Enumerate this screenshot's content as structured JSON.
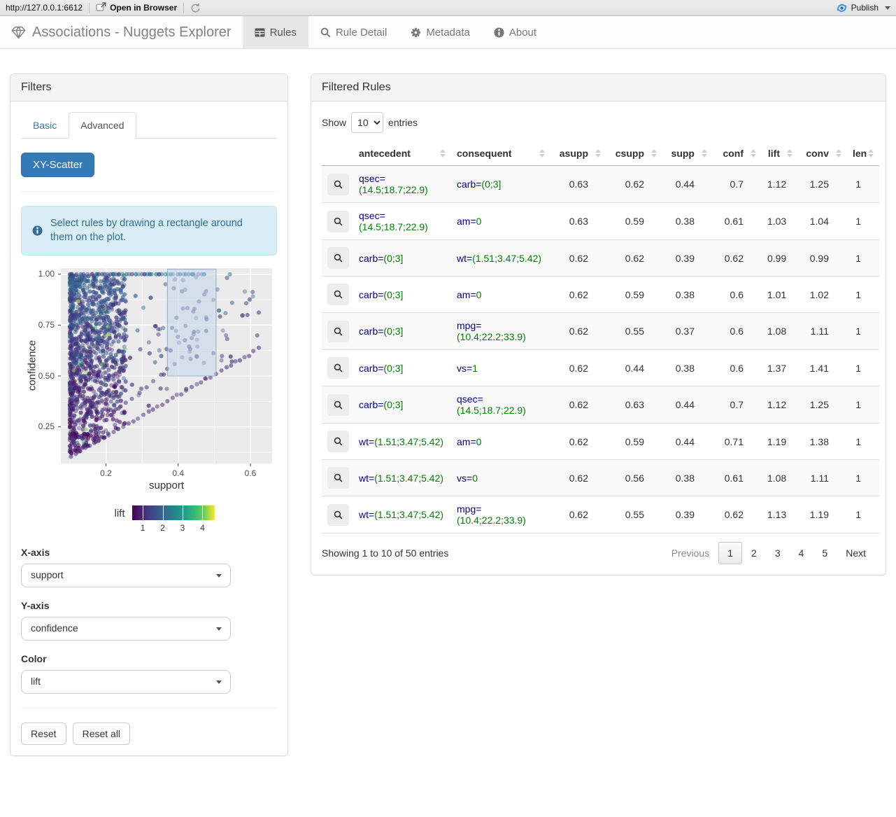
{
  "browser": {
    "url": "http://127.0.0.1:6612",
    "open_in_browser": "Open in Browser",
    "publish": "Publish"
  },
  "navbar": {
    "title": "Associations - Nuggets Explorer",
    "tabs": [
      {
        "label": "Rules",
        "icon": "table-icon",
        "active": true
      },
      {
        "label": "Rule Detail",
        "icon": "search-icon",
        "active": false
      },
      {
        "label": "Metadata",
        "icon": "gear-icon",
        "active": false
      },
      {
        "label": "About",
        "icon": "info-icon",
        "active": false
      }
    ]
  },
  "filters": {
    "title": "Filters",
    "tabs": [
      {
        "label": "Basic",
        "active": false
      },
      {
        "label": "Advanced",
        "active": true
      }
    ],
    "scatter_button": "XY-Scatter",
    "info_text": "Select rules by drawing a rectangle around them on the plot.",
    "controls": [
      {
        "label": "X-axis",
        "value": "support",
        "name": "x-axis"
      },
      {
        "label": "Y-axis",
        "value": "confidence",
        "name": "y-axis"
      },
      {
        "label": "Color",
        "value": "lift",
        "name": "color"
      }
    ],
    "reset": "Reset",
    "reset_all": "Reset all"
  },
  "chart_data": {
    "type": "scatter",
    "xlabel": "support",
    "ylabel": "confidence",
    "xlim": [
      0.075,
      0.66
    ],
    "ylim": [
      0.07,
      1.03
    ],
    "x_ticks": [
      {
        "v": 0.2,
        "label": "0.2"
      },
      {
        "v": 0.4,
        "label": "0.4"
      },
      {
        "v": 0.6,
        "label": "0.6"
      }
    ],
    "x_minor": [
      0.1,
      0.3,
      0.5
    ],
    "y_ticks": [
      {
        "v": 0.25,
        "label": "0.25"
      },
      {
        "v": 0.5,
        "label": "0.50"
      },
      {
        "v": 0.75,
        "label": "0.75"
      },
      {
        "v": 1.0,
        "label": "1.00"
      }
    ],
    "y_minor": [
      0.125,
      0.375,
      0.625,
      0.875
    ],
    "grid": true,
    "panel_bg": "#EBEBEB",
    "legend": {
      "label": "lift",
      "ticks": [
        1,
        2,
        3,
        4
      ],
      "range": [
        0.45,
        4.6
      ],
      "colormap": "viridis"
    },
    "brush": {
      "x1": 0.37,
      "x2": 0.505,
      "y1": 0.5,
      "y2": 1.025
    },
    "n_points": 1500,
    "seed": 7
  },
  "colors": {
    "accent": "#337ab7",
    "attr": "#00008B",
    "value": "#008000",
    "viridis": [
      "#440154",
      "#482878",
      "#3e4a89",
      "#31688e",
      "#26828e",
      "#1f9e89",
      "#35b779",
      "#6ece58",
      "#fde725"
    ]
  },
  "table": {
    "title": "Filtered Rules",
    "show_label": "Show",
    "page_length": "10",
    "entries_label": "entries",
    "columns": [
      "antecedent",
      "consequent",
      "asupp",
      "csupp",
      "supp",
      "conf",
      "lift",
      "conv",
      "len"
    ],
    "rows": [
      {
        "antecedent": {
          "attr": "qsec=",
          "value": "(14.5;18.7;22.9)"
        },
        "consequent": {
          "attr": "carb=",
          "value": "(0;3]"
        },
        "values": [
          "0.63",
          "0.62",
          "0.44",
          "0.7",
          "1.12",
          "1.25",
          "1"
        ]
      },
      {
        "antecedent": {
          "attr": "qsec=",
          "value": "(14.5;18.7;22.9)"
        },
        "consequent": {
          "attr": "am=",
          "value": "0"
        },
        "values": [
          "0.63",
          "0.59",
          "0.38",
          "0.61",
          "1.03",
          "1.04",
          "1"
        ]
      },
      {
        "antecedent": {
          "attr": "carb=",
          "value": "(0;3]"
        },
        "consequent": {
          "attr": "wt=",
          "value": "(1.51;3.47;5.42)"
        },
        "values": [
          "0.62",
          "0.62",
          "0.39",
          "0.62",
          "0.99",
          "0.99",
          "1"
        ]
      },
      {
        "antecedent": {
          "attr": "carb=",
          "value": "(0;3]"
        },
        "consequent": {
          "attr": "am=",
          "value": "0"
        },
        "values": [
          "0.62",
          "0.59",
          "0.38",
          "0.6",
          "1.01",
          "1.02",
          "1"
        ]
      },
      {
        "antecedent": {
          "attr": "carb=",
          "value": "(0;3]"
        },
        "consequent": {
          "attr": "mpg=",
          "value": "(10.4;22.2;33.9)"
        },
        "values": [
          "0.62",
          "0.55",
          "0.37",
          "0.6",
          "1.08",
          "1.11",
          "1"
        ]
      },
      {
        "antecedent": {
          "attr": "carb=",
          "value": "(0;3]"
        },
        "consequent": {
          "attr": "vs=",
          "value": "1"
        },
        "values": [
          "0.62",
          "0.44",
          "0.38",
          "0.6",
          "1.37",
          "1.41",
          "1"
        ]
      },
      {
        "antecedent": {
          "attr": "carb=",
          "value": "(0;3]"
        },
        "consequent": {
          "attr": "qsec=",
          "value": "(14.5;18.7;22.9)"
        },
        "values": [
          "0.62",
          "0.63",
          "0.44",
          "0.7",
          "1.12",
          "1.25",
          "1"
        ]
      },
      {
        "antecedent": {
          "attr": "wt=",
          "value": "(1.51;3.47;5.42)"
        },
        "consequent": {
          "attr": "am=",
          "value": "0"
        },
        "values": [
          "0.62",
          "0.59",
          "0.44",
          "0.71",
          "1.19",
          "1.38",
          "1"
        ]
      },
      {
        "antecedent": {
          "attr": "wt=",
          "value": "(1.51;3.47;5.42)"
        },
        "consequent": {
          "attr": "vs=",
          "value": "0"
        },
        "values": [
          "0.62",
          "0.56",
          "0.38",
          "0.61",
          "1.08",
          "1.11",
          "1"
        ]
      },
      {
        "antecedent": {
          "attr": "wt=",
          "value": "(1.51;3.47;5.42)"
        },
        "consequent": {
          "attr": "mpg=",
          "value": "(10.4;22.2;33.9)"
        },
        "values": [
          "0.62",
          "0.55",
          "0.39",
          "0.62",
          "1.13",
          "1.19",
          "1"
        ]
      }
    ],
    "info": "Showing 1 to 10 of 50 entries",
    "pagination": {
      "previous": "Previous",
      "pages": [
        "1",
        "2",
        "3",
        "4",
        "5"
      ],
      "active": "1",
      "next": "Next"
    }
  }
}
